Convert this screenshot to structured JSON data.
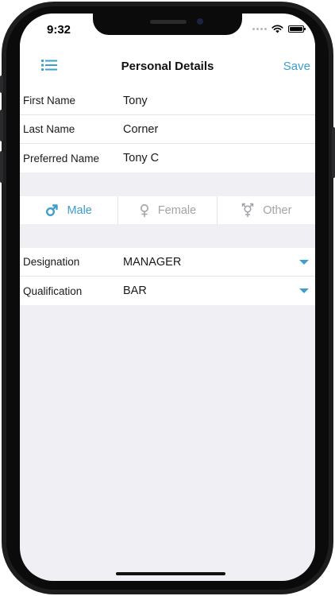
{
  "status": {
    "time": "9:32"
  },
  "nav": {
    "title": "Personal Details",
    "save_label": "Save",
    "menu_icon": "list-icon"
  },
  "name_fields": [
    {
      "label": "First Name",
      "value": "Tony"
    },
    {
      "label": "Last Name",
      "value": "Corner"
    },
    {
      "label": "Preferred Name",
      "value": "Tony C"
    }
  ],
  "gender": {
    "options": [
      {
        "label": "Male",
        "icon": "male-symbol-icon"
      },
      {
        "label": "Female",
        "icon": "female-symbol-icon"
      },
      {
        "label": "Other",
        "icon": "transgender-symbol-icon"
      }
    ],
    "selected": "Male"
  },
  "pickers": [
    {
      "label": "Designation",
      "value": "MANAGER"
    },
    {
      "label": "Qualification",
      "value": "BAR"
    }
  ],
  "colors": {
    "accent": "#3d9ecf",
    "background": "#efeff4",
    "inactive": "#a3a3a8"
  }
}
